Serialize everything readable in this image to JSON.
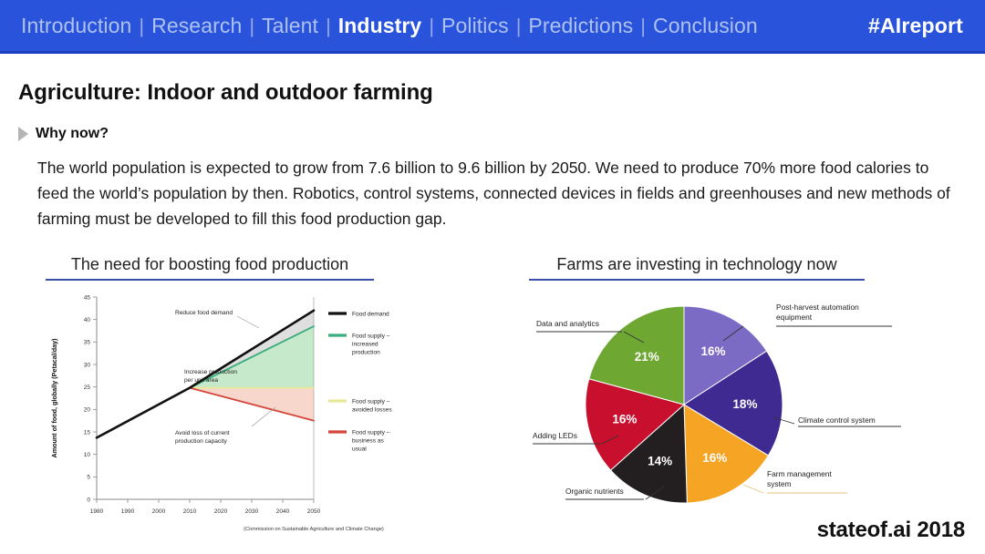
{
  "nav": {
    "items": [
      {
        "label": "Introduction",
        "active": false
      },
      {
        "label": "Research",
        "active": false
      },
      {
        "label": "Talent",
        "active": false
      },
      {
        "label": "Industry",
        "active": true
      },
      {
        "label": "Politics",
        "active": false
      },
      {
        "label": "Predictions",
        "active": false
      },
      {
        "label": "Conclusion",
        "active": false
      }
    ],
    "separator": "|",
    "hashtag": "#AIreport",
    "bar_color": "#2A53DC",
    "active_color": "#FFFFFF",
    "inactive_color": "#AEC2F0"
  },
  "slide": {
    "title": "Agriculture: Indoor and outdoor farming",
    "why_label": "Why now?",
    "body": "The world population is expected to grow from 7.6 billion to 9.6 billion by 2050. We need to produce 70% more food calories to feed the world’s population by then. Robotics, control systems, connected devices in fields and greenhouses and new methods of farming must be developed to fill this food production gap.",
    "footer_logo": "stateof.ai 2018",
    "accent_color": "#3B4FA8"
  },
  "panels": {
    "left_caption": "The need for boosting food production",
    "right_caption": "Farms are investing in technology now"
  },
  "chart_data": [
    {
      "type": "line",
      "title": "The need for boosting food production",
      "xlabel": "",
      "ylabel": "Amount of food, globally (Petacal/day)",
      "xlim": [
        1980,
        2050
      ],
      "ylim": [
        0,
        45
      ],
      "xticks": [
        1980,
        1990,
        2000,
        2010,
        2020,
        2030,
        2040,
        2050
      ],
      "yticks": [
        0,
        5,
        10,
        15,
        20,
        25,
        30,
        35,
        40,
        45
      ],
      "grid": false,
      "legend_position": "right",
      "source_note": "(Commission on Sustainable Agriculture and Climate Change)",
      "annotations": [
        "Reduce food demand",
        "Increase production per unit area",
        "Avoid loss of current production capacity"
      ],
      "series": [
        {
          "name": "Food demand",
          "color": "#111111",
          "x": [
            1980,
            2010,
            2050
          ],
          "values": [
            13.7,
            24.8,
            42.0
          ]
        },
        {
          "name": "Food supply – increased production",
          "color": "#3DAE7F",
          "x": [
            1980,
            2010,
            2050
          ],
          "values": [
            13.7,
            24.8,
            38.5
          ]
        },
        {
          "name": "Food supply – avoided losses",
          "color": "#E8E89A",
          "x": [
            1980,
            2010,
            2050
          ],
          "values": [
            13.7,
            24.8,
            24.8
          ]
        },
        {
          "name": "Food supply – business as usual",
          "color": "#D4453A",
          "x": [
            1980,
            2010,
            2050
          ],
          "values": [
            13.7,
            24.8,
            17.5
          ]
        }
      ]
    },
    {
      "type": "pie",
      "title": "Farms are investing in technology now",
      "legend_position": "callout-labels",
      "categories": [
        "Post-harvest automation equipment",
        "Climate control system",
        "Farm management system",
        "Organic nutrients",
        "Adding LEDs",
        "Data and analytics"
      ],
      "values": [
        16,
        18,
        16,
        14,
        16,
        21
      ],
      "value_labels": [
        "16%",
        "18%",
        "16%",
        "14%",
        "16%",
        "21%"
      ],
      "colors": [
        "#7B6BC4",
        "#3F2A91",
        "#F5A423",
        "#231F20",
        "#C8102E",
        "#6EA832"
      ]
    }
  ]
}
